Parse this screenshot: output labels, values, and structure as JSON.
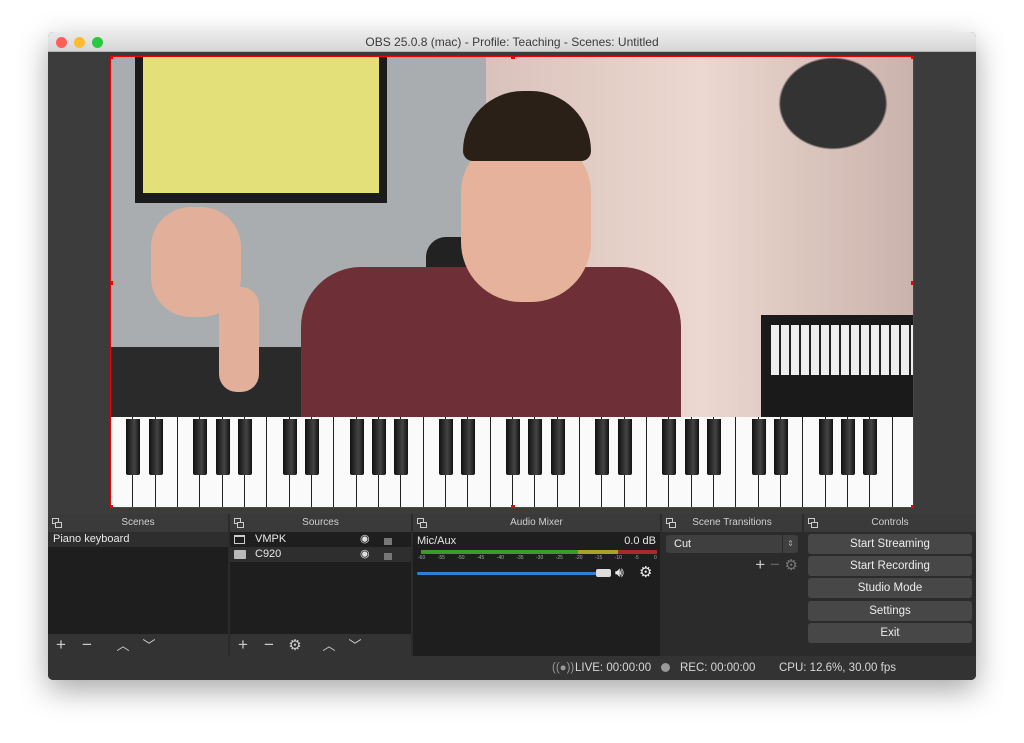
{
  "window": {
    "title": "OBS 25.0.8 (mac) - Profile: Teaching - Scenes: Untitled"
  },
  "docks": {
    "scenes": {
      "title": "Scenes",
      "items": [
        "Piano keyboard"
      ]
    },
    "sources": {
      "title": "Sources",
      "items": [
        {
          "name": "VMPK",
          "icon": "window-icon",
          "visible": true,
          "locked": false
        },
        {
          "name": "C920",
          "icon": "camera-icon",
          "visible": true,
          "locked": false
        }
      ]
    },
    "mixer": {
      "title": "Audio Mixer",
      "channel": "Mic/Aux",
      "level": "0.0 dB",
      "ticks": [
        "-60",
        "-55",
        "-50",
        "-45",
        "-40",
        "-35",
        "-30",
        "-25",
        "-20",
        "-15",
        "-10",
        "-5",
        "0"
      ],
      "volume_fraction": 1.0
    },
    "transitions": {
      "title": "Scene Transitions",
      "selected": "Cut"
    },
    "controls": {
      "title": "Controls",
      "buttons": [
        "Start Streaming",
        "Start Recording",
        "Studio Mode",
        "Settings",
        "Exit"
      ]
    }
  },
  "status": {
    "live": "LIVE: 00:00:00",
    "rec": "REC: 00:00:00",
    "cpu": "CPU: 12.6%, 30.00 fps"
  },
  "colors": {
    "meter_green": "#3a9a2a",
    "meter_yellow": "#a8a22a",
    "meter_red": "#a82a2a",
    "volume_blue": "#2f7fd8",
    "selection_red": "#e00000"
  }
}
